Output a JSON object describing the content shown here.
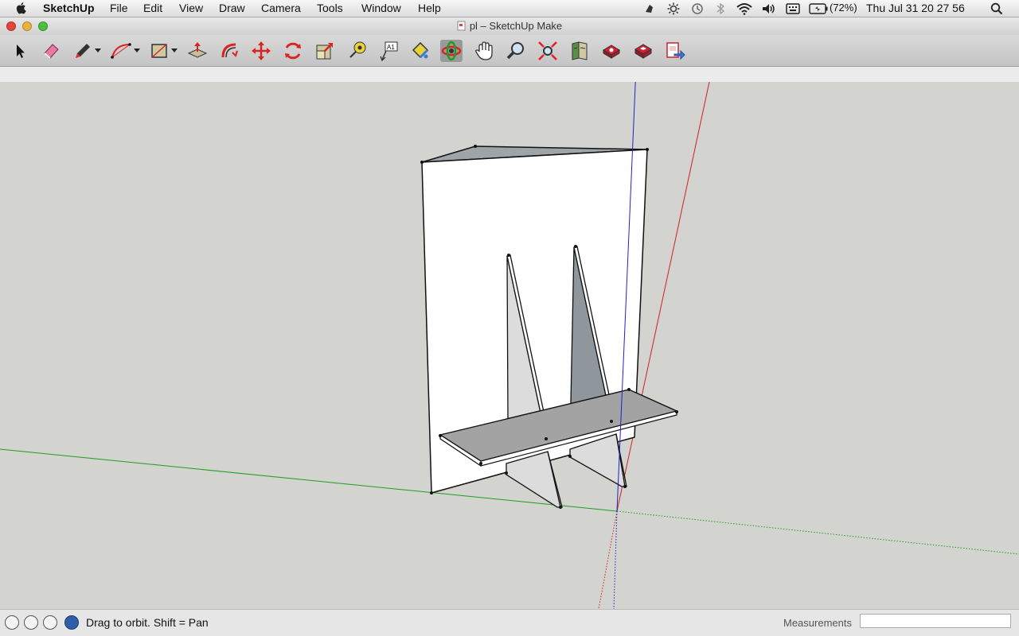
{
  "menubar": {
    "app_name": "SketchUp",
    "items": [
      "File",
      "Edit",
      "View",
      "Draw",
      "Camera",
      "Tools",
      "Window",
      "Help"
    ],
    "battery": "(72%)",
    "clock": "Thu Jul 31  20 27 56"
  },
  "window": {
    "title": "pl – SketchUp Make"
  },
  "toolbar": {
    "tools": [
      "select-tool",
      "eraser-tool",
      "pencil-tool",
      "arc-tool",
      "rectangle-tool",
      "push-pull-tool",
      "offset-tool",
      "move-tool",
      "rotate-tool",
      "scale-tool",
      "tape-measure-tool",
      "text-tool",
      "paint-bucket-tool",
      "orbit-tool",
      "pan-tool",
      "zoom-tool",
      "zoom-extents-tool",
      "warehouse-tool",
      "extension-tool",
      "share-model-tool",
      "send-to-layout-tool"
    ],
    "active_tool": "orbit-tool"
  },
  "statusbar": {
    "hint": "Drag to orbit.  Shift = Pan",
    "measurements_label": "Measurements",
    "measurements_value": ""
  },
  "colors": {
    "viewport_bg": "#d3d3cf",
    "axis_red": "#d22020",
    "axis_green": "#1e9e1e",
    "axis_blue": "#2020d0",
    "face_white": "#ffffff",
    "face_grey": "#9ea4a8",
    "shelf_grey": "#a3a3a3"
  }
}
